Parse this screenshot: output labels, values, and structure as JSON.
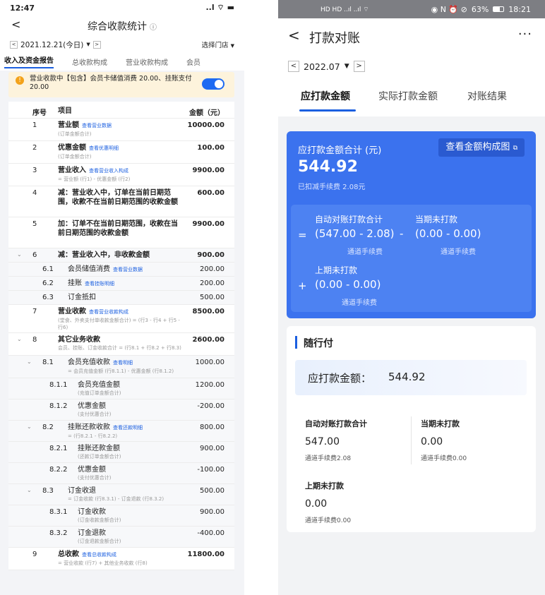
{
  "left": {
    "status_time": "12:47",
    "status_icons": "..l ⌔ ▬",
    "back": "<",
    "title": "综合收款统计",
    "help_icon": "ⓘ",
    "date": "2021.12.21(今日)",
    "store": "选择门店",
    "tabs": [
      "收入及资金报告",
      "总收款构成",
      "营业收款构成",
      "会员"
    ],
    "notice": "营业收款中【包含】会员卡储值消费 20.00、挂账支付 20.00",
    "head_no": "序号",
    "head_item": "项目",
    "head_amt": "金额（元）",
    "rows": [
      {
        "no": "1",
        "name": "营业额",
        "link": "查看营业数据",
        "sub": "(订单金额合计)",
        "amt": "10000.00"
      },
      {
        "no": "2",
        "name": "优惠金额",
        "link": "查看优惠明细",
        "sub": "(订单金额合计)",
        "amt": "100.00"
      },
      {
        "no": "3",
        "name": "营业收入",
        "link": "查看营业收入构成",
        "sub": "= 营业额 (行1) - 优惠金额 (行2)",
        "amt": "9900.00"
      },
      {
        "no": "4",
        "name": "减：营业收入中，订单在当前日期范围，收款不在当前日期范围的收款金额",
        "link": "",
        "sub": "",
        "amt": "600.00"
      },
      {
        "no": "5",
        "name": "加：订单不在当前日期范围，收款在当前日期范围的收款金额",
        "link": "",
        "sub": "",
        "amt": "9900.00"
      },
      {
        "no": "6",
        "name": "减：营业收入中，非收款金额",
        "link": "",
        "sub": "",
        "amt": "900.00"
      },
      {
        "no": "6.1",
        "name": "会员储值消费",
        "link": "查看营业数据",
        "sub": "",
        "amt": "200.00"
      },
      {
        "no": "6.2",
        "name": "挂账",
        "link": "查看挂账明细",
        "sub": "",
        "amt": "200.00"
      },
      {
        "no": "6.3",
        "name": "订金抵扣",
        "link": "",
        "sub": "",
        "amt": "500.00"
      },
      {
        "no": "7",
        "name": "营业收款",
        "link": "查看营业收款构成",
        "sub": "(堂食、外卖支付单收款金额合计) = (行3 - 行4 + 行5 - 行6)",
        "amt": "8500.00"
      },
      {
        "no": "8",
        "name": "其它业务收款",
        "link": "",
        "sub": "会员、挂账、订金收款合计 = (行8.1 + 行8.2 + 行8.3)",
        "amt": "2600.00"
      },
      {
        "no": "8.1",
        "name": "会员充值收款",
        "link": "查看明细",
        "sub": "= 会员充值金额 (行8.1.1) - 优惠金额 (行8.1.2)",
        "amt": "1000.00"
      },
      {
        "no": "8.1.1",
        "name": "会员充值金额",
        "link": "",
        "sub": "(充值订单金额合计)",
        "amt": "1200.00"
      },
      {
        "no": "8.1.2",
        "name": "优惠金额",
        "link": "",
        "sub": "(支付优惠合计)",
        "amt": "-200.00"
      },
      {
        "no": "8.2",
        "name": "挂账还款收款",
        "link": "查看还款明细",
        "sub": "= (行8.2.1 - 行8.2.2)",
        "amt": "800.00"
      },
      {
        "no": "8.2.1",
        "name": "挂账还款金额",
        "link": "",
        "sub": "(还款订单金额合计)",
        "amt": "900.00"
      },
      {
        "no": "8.2.2",
        "name": "优惠金额",
        "link": "",
        "sub": "(支付优惠合计)",
        "amt": "-100.00"
      },
      {
        "no": "8.3",
        "name": "订金收退",
        "link": "",
        "sub": "= 订金收款 (行8.3.1) - 订金退款 (行8.3.2)",
        "amt": "500.00"
      },
      {
        "no": "8.3.1",
        "name": "订金收款",
        "link": "",
        "sub": "(订金收款金额合计)",
        "amt": "900.00"
      },
      {
        "no": "8.3.2",
        "name": "订金退款",
        "link": "",
        "sub": "(订金退款金额合计)",
        "amt": "-400.00"
      },
      {
        "no": "9",
        "name": "总收款",
        "link": "查看总收款构成",
        "sub": "= 营业收款 (行7) + 其他业务收款 (行8)",
        "amt": "11800.00"
      }
    ]
  },
  "right": {
    "status_time": "18:21",
    "status_battery": "63%",
    "status_icons_left": "HD HD ..ıl ..ıl ⌔",
    "status_icons_right": "◉ N ⏰ ⊘",
    "back": "<",
    "title": "打款对账",
    "more": "···",
    "month": "2022.07",
    "tabs": [
      "应打款金额",
      "实际打款金额",
      "对账结果"
    ],
    "card_label": "应打款金额合计 (元)",
    "card_amount": "544.92",
    "card_note": "已扣减手续费 2.08元",
    "card_button": "查看金额构成图",
    "f1_label1": "自动对账打款合计",
    "f1_label2": "当期未打款",
    "f1_eq": "=",
    "f1_val1": "(547.00 - 2.08)",
    "f1_minus": "-",
    "f1_val2": "(0.00 - 0.00)",
    "f1_fee1": "通道手续费",
    "f1_fee2": "通道手续费",
    "f2_label": "上期未打款",
    "f2_plus": "+",
    "f2_val": "(0.00 - 0.00)",
    "f2_fee": "通道手续费",
    "section_title": "随行付",
    "sum_label": "应打款金额：",
    "sum_value": "544.92",
    "cells": [
      {
        "label": "自动对账打款合计",
        "value": "547.00",
        "fee": "通道手续费2.08"
      },
      {
        "label": "当期未打款",
        "value": "0.00",
        "fee": "通道手续费0.00"
      },
      {
        "label": "上期未打款",
        "value": "0.00",
        "fee": "通道手续费0.00"
      }
    ]
  },
  "colors": {
    "accent": "#1b5fe0",
    "card_blue": "#3b72ee",
    "notice_bg": "#fdf3dc",
    "toggle": "#1d6af2"
  }
}
